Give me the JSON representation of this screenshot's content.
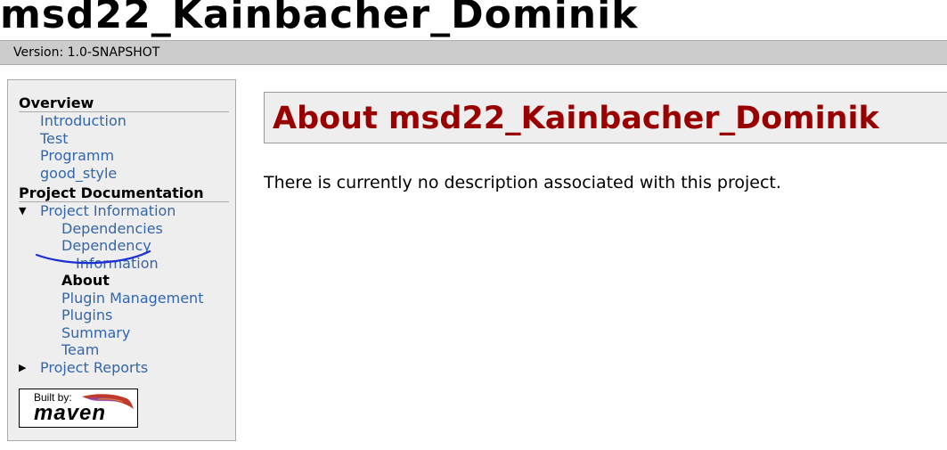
{
  "banner": {
    "title": "msd22_Kainbacher_Dominik"
  },
  "breadcrumbs": {
    "version": "Version: 1.0-SNAPSHOT"
  },
  "sidebar": {
    "overview_heading": "Overview",
    "overview_links": [
      "Introduction",
      "Test",
      "Programm",
      "good_style"
    ],
    "project_doc_heading": "Project Documentation",
    "project_info_label": "Project Information",
    "project_info_items": [
      "Dependencies",
      "Dependency",
      "Information",
      "About",
      "Plugin Management",
      "Plugins",
      "Summary",
      "Team"
    ],
    "project_reports_label": "Project Reports",
    "badge": {
      "built_by": "Built by:",
      "brand": "maven"
    }
  },
  "content": {
    "heading": "About msd22_Kainbacher_Dominik",
    "description": "There is currently no description associated with this project."
  },
  "colors": {
    "link": "#3366aa",
    "heading_red": "#990000",
    "annotation_blue": "#1a2fd4"
  }
}
